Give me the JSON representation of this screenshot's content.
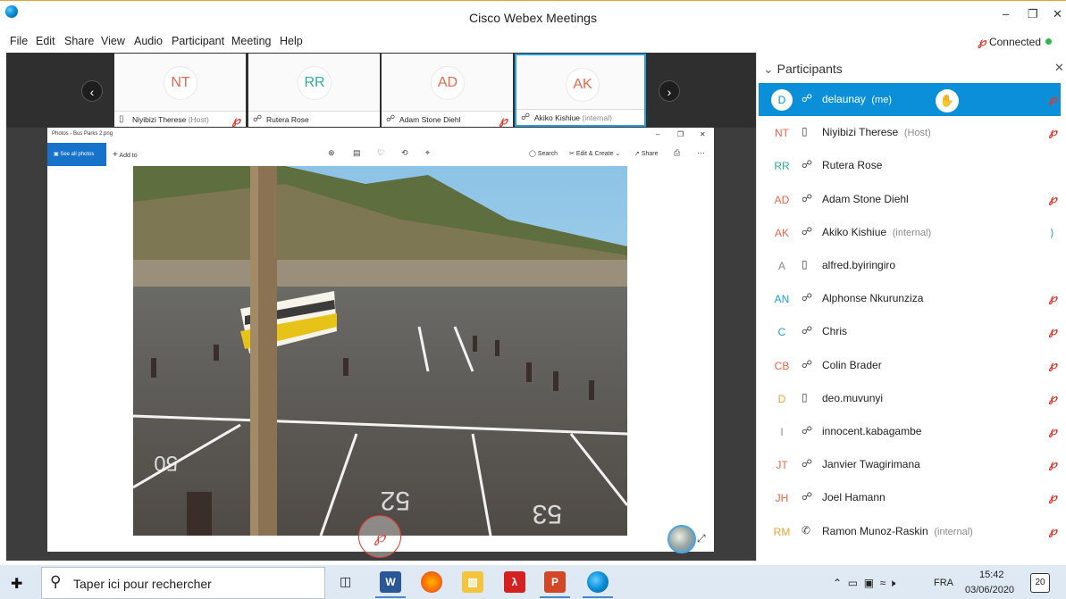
{
  "window": {
    "title": "Cisco Webex Meetings",
    "status": "Connected"
  },
  "menu": [
    "File",
    "Edit",
    "Share",
    "View",
    "Audio",
    "Participant",
    "Meeting",
    "Help"
  ],
  "thumbnails": [
    {
      "initials": "NT",
      "name": "Niyibizi Therese",
      "tag": "(Host)",
      "color": "#e8674d"
    },
    {
      "initials": "RR",
      "name": "Rutera Rose",
      "tag": "",
      "color": "#2eae96"
    },
    {
      "initials": "AD",
      "name": "Adam Stone Diehl",
      "tag": "",
      "color": "#e8674d"
    },
    {
      "initials": "AK",
      "name": "Akiko Kishiue",
      "tag": "(internal)",
      "color": "#e8674d"
    }
  ],
  "photos_app": {
    "title": "Photos - Bus Parks 2.png",
    "see_all": "See all photos",
    "add_to": "Add to",
    "search": "Search",
    "edit_create": "Edit & Create",
    "share": "Share"
  },
  "photo": {
    "parking_numbers": [
      "52",
      "53",
      "50"
    ]
  },
  "participants_panel": {
    "header": "Participants",
    "items": [
      {
        "initials": "D",
        "name": "delaunay",
        "tag": "(me)",
        "device": "headset",
        "muted": true,
        "color": "#0a8fd8"
      },
      {
        "initials": "NT",
        "name": "Niyibizi Therese",
        "tag": "(Host)",
        "device": "phone",
        "muted": true,
        "color": "#e8674d"
      },
      {
        "initials": "RR",
        "name": "Rutera Rose",
        "tag": "",
        "device": "headset",
        "muted": false,
        "color": "#2eae96"
      },
      {
        "initials": "AD",
        "name": "Adam Stone Diehl",
        "tag": "",
        "device": "headset",
        "muted": true,
        "color": "#e8674d"
      },
      {
        "initials": "AK",
        "name": "Akiko Kishiue",
        "tag": "(internal)",
        "device": "headset",
        "muted": false,
        "color": "#e8674d"
      },
      {
        "initials": "A",
        "name": "alfred.byiringiro",
        "tag": "",
        "device": "phone",
        "muted": false,
        "color": "#888888"
      },
      {
        "initials": "AN",
        "name": "Alphonse Nkurunziza",
        "tag": "",
        "device": "headset",
        "muted": true,
        "color": "#1a9bd9"
      },
      {
        "initials": "C",
        "name": "Chris",
        "tag": "",
        "device": "headset",
        "muted": true,
        "color": "#1a9bd9"
      },
      {
        "initials": "CB",
        "name": "Colin Brader",
        "tag": "",
        "device": "headset",
        "muted": true,
        "color": "#e8674d"
      },
      {
        "initials": "D",
        "name": "deo.muvunyi",
        "tag": "",
        "device": "phone",
        "muted": true,
        "color": "#e8a33b"
      },
      {
        "initials": "I",
        "name": "innocent.kabagambe",
        "tag": "",
        "device": "headset",
        "muted": true,
        "color": "#888888"
      },
      {
        "initials": "JT",
        "name": "Janvier Twagirimana",
        "tag": "",
        "device": "headset",
        "muted": true,
        "color": "#e8674d"
      },
      {
        "initials": "JH",
        "name": "Joel Hamann",
        "tag": "",
        "device": "headset",
        "muted": true,
        "color": "#e8674d"
      },
      {
        "initials": "RM",
        "name": "Ramon Munoz-Raskin",
        "tag": "(internal)",
        "device": "call",
        "muted": true,
        "color": "#e8a33b"
      }
    ]
  },
  "taskbar": {
    "search_placeholder": "Taper ici pour rechercher",
    "language": "FRA",
    "time": "15:42",
    "date": "03/06/2020",
    "notifications": "20"
  }
}
